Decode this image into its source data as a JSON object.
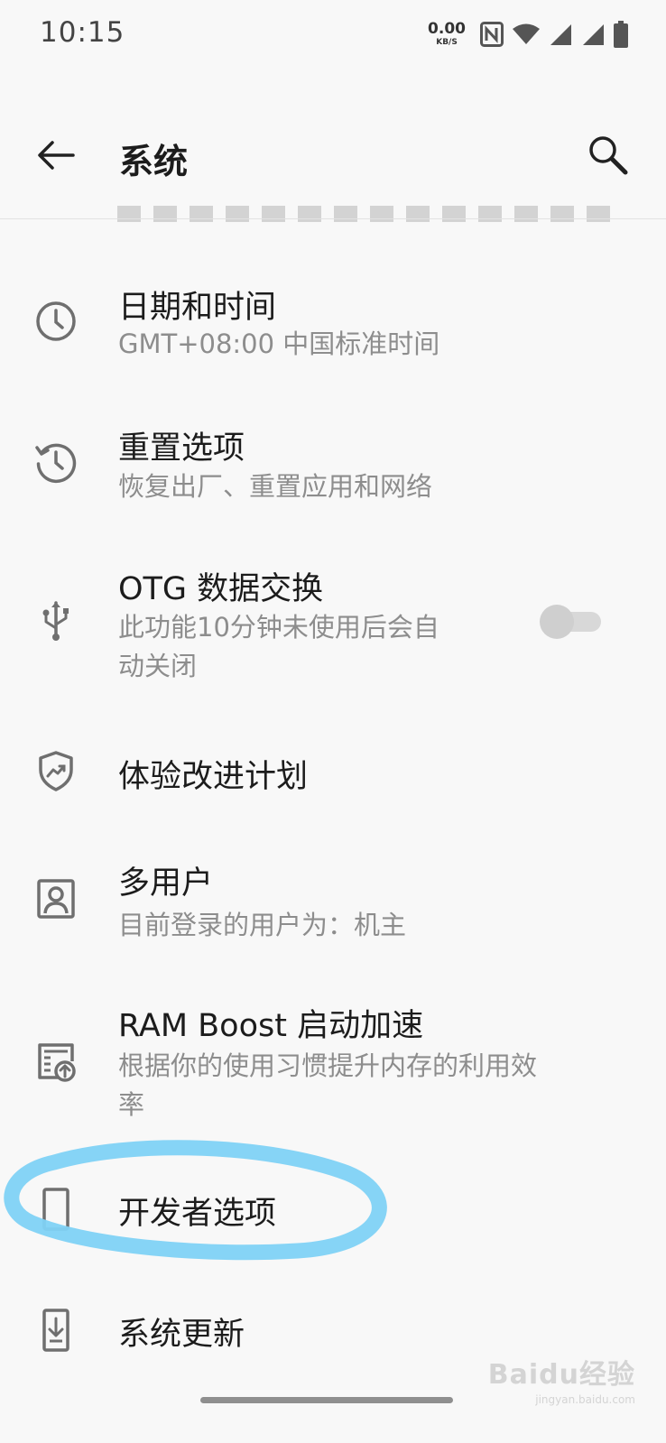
{
  "status_bar": {
    "time": "10:15",
    "net_speed_value": "0.00",
    "net_speed_unit": "KB/S"
  },
  "header": {
    "title": "系统",
    "back_icon": "arrow-left-icon",
    "search_icon": "search-icon"
  },
  "items": [
    {
      "title": "日期和时间",
      "subtitle": "GMT+08:00 中国标准时间",
      "icon": "clock-icon"
    },
    {
      "title": "重置选项",
      "subtitle": "恢复出厂、重置应用和网络",
      "icon": "history-icon"
    },
    {
      "title": "OTG 数据交换",
      "subtitle_line1": "此功能10分钟未使用后会自",
      "subtitle_line2": "动关闭",
      "icon": "usb-icon",
      "toggle_on": false
    },
    {
      "title": "体验改进计划",
      "icon": "shield-trend-icon"
    },
    {
      "title": "多用户",
      "subtitle": "目前登录的用户为：机主",
      "icon": "user-icon"
    },
    {
      "title": "RAM Boost 启动加速",
      "subtitle_line1": "根据你的使用习惯提升内存的利用效",
      "subtitle_line2": "率",
      "icon": "ram-boost-icon"
    },
    {
      "title": "开发者选项",
      "icon": "phone-icon"
    },
    {
      "title": "系统更新",
      "icon": "system-update-icon"
    }
  ],
  "watermark": {
    "brand": "Baidu经验",
    "url": "jingyan.baidu.com"
  },
  "colors": {
    "background": "#f8f8f8",
    "primary_text": "#1c1c1c",
    "secondary_text": "#8d8d8d",
    "icon": "#6f6f6f",
    "highlight_annotation": "#7fd2f5"
  }
}
